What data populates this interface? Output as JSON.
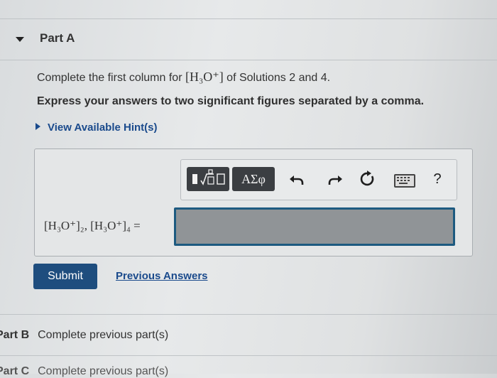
{
  "part_a": {
    "title": "Part A",
    "question_prefix": "Complete the first column for ",
    "question_chem": "[H₃O⁺]",
    "question_suffix": " of Solutions 2 and 4.",
    "instruction": "Express your answers to two significant figures separated by a comma.",
    "hint_label": "View Available Hint(s)",
    "toolbar": {
      "greek_label": "ΑΣφ",
      "help_label": "?"
    },
    "answer_label": "[H₃O⁺]₂, [H₃O⁺]₄ =",
    "answer_value": "",
    "submit_label": "Submit",
    "previous_answers_label": "Previous Answers"
  },
  "part_b": {
    "title": "Part B",
    "status": "Complete previous part(s)"
  },
  "part_c": {
    "title": "Part C",
    "status": "Complete previous part(s)"
  }
}
